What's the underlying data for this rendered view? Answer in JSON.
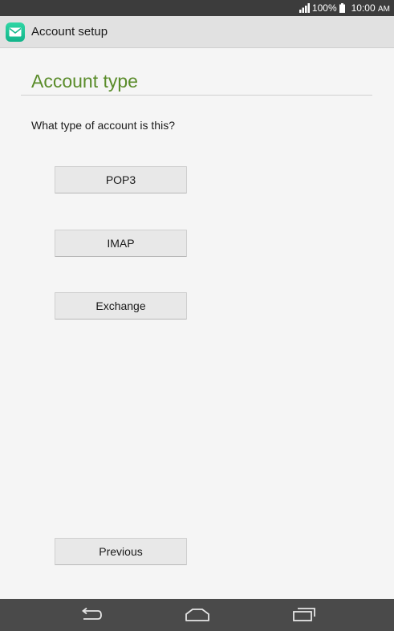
{
  "status_bar": {
    "battery": "100%",
    "time": "10:00",
    "time_period": "AM",
    "icons": [
      "signal-icon",
      "battery-icon"
    ]
  },
  "action_bar": {
    "title": "Account setup",
    "app_icon": "email-app-icon"
  },
  "page": {
    "heading": "Account type",
    "question": "What type of account is this?",
    "options": [
      "POP3",
      "IMAP",
      "Exchange"
    ],
    "previous_label": "Previous"
  },
  "nav_bar": {
    "icons": [
      "back-icon",
      "home-icon",
      "recents-icon"
    ]
  },
  "colors": {
    "heading": "#5a8c2a",
    "app_icon": "#1fc597",
    "status_bar": "#3c3c3c",
    "nav_bar": "#4a4a4a"
  }
}
